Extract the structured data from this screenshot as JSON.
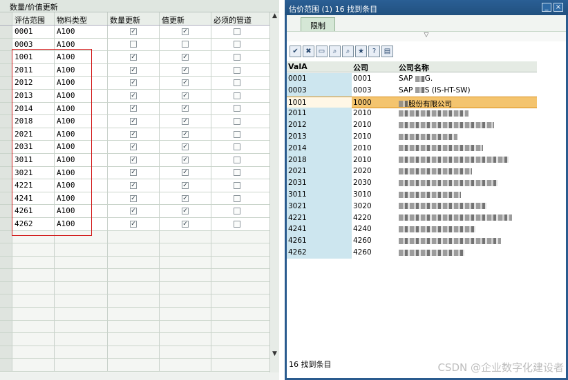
{
  "left": {
    "title": "数量/价值更新",
    "columns": [
      "评估范围",
      "物料类型",
      "数量更新",
      "值更新",
      "必须的管道"
    ],
    "rows": [
      {
        "a": "0001",
        "b": "A100",
        "q": true,
        "v": true,
        "p": false
      },
      {
        "a": "0003",
        "b": "A100",
        "q": false,
        "v": false,
        "p": false
      },
      {
        "a": "1001",
        "b": "A100",
        "q": true,
        "v": true,
        "p": false
      },
      {
        "a": "2011",
        "b": "A100",
        "q": true,
        "v": true,
        "p": false
      },
      {
        "a": "2012",
        "b": "A100",
        "q": true,
        "v": true,
        "p": false
      },
      {
        "a": "2013",
        "b": "A100",
        "q": true,
        "v": true,
        "p": false
      },
      {
        "a": "2014",
        "b": "A100",
        "q": true,
        "v": true,
        "p": false
      },
      {
        "a": "2018",
        "b": "A100",
        "q": true,
        "v": true,
        "p": false
      },
      {
        "a": "2021",
        "b": "A100",
        "q": true,
        "v": true,
        "p": false
      },
      {
        "a": "2031",
        "b": "A100",
        "q": true,
        "v": true,
        "p": false
      },
      {
        "a": "3011",
        "b": "A100",
        "q": true,
        "v": true,
        "p": false
      },
      {
        "a": "3021",
        "b": "A100",
        "q": true,
        "v": true,
        "p": false
      },
      {
        "a": "4221",
        "b": "A100",
        "q": true,
        "v": true,
        "p": false
      },
      {
        "a": "4241",
        "b": "A100",
        "q": true,
        "v": true,
        "p": false
      },
      {
        "a": "4261",
        "b": "A100",
        "q": true,
        "v": true,
        "p": false
      },
      {
        "a": "4262",
        "b": "A100",
        "q": true,
        "v": true,
        "p": false
      }
    ],
    "empty_rows": 11
  },
  "right": {
    "title": "估价范围 (1)   16 找到条目",
    "tab": "限制",
    "cols": [
      "ValA",
      "公司",
      "公司名称"
    ],
    "rows": [
      {
        "a": "0001",
        "b": "0001",
        "c": "SAP",
        "c2": "G."
      },
      {
        "a": "0003",
        "b": "0003",
        "c": "SAP",
        "c2": "S (IS-HT-SW)"
      },
      {
        "a": "1001",
        "b": "1000",
        "c": "",
        "c2": "股份有限公司"
      },
      {
        "a": "2011",
        "b": "2010",
        "c": "",
        "c2": ""
      },
      {
        "a": "2012",
        "b": "2010",
        "c": "",
        "c2": ""
      },
      {
        "a": "2013",
        "b": "2010",
        "c": "",
        "c2": ""
      },
      {
        "a": "2014",
        "b": "2010",
        "c": "",
        "c2": ""
      },
      {
        "a": "2018",
        "b": "2010",
        "c": "",
        "c2": ""
      },
      {
        "a": "2021",
        "b": "2020",
        "c": "",
        "c2": ""
      },
      {
        "a": "2031",
        "b": "2030",
        "c": "",
        "c2": ""
      },
      {
        "a": "3011",
        "b": "3010",
        "c": "",
        "c2": ""
      },
      {
        "a": "3021",
        "b": "3020",
        "c": "",
        "c2": ""
      },
      {
        "a": "4221",
        "b": "4220",
        "c": "",
        "c2": ""
      },
      {
        "a": "4241",
        "b": "4240",
        "c": "",
        "c2": ""
      },
      {
        "a": "4261",
        "b": "4260",
        "c": "",
        "c2": ""
      },
      {
        "a": "4262",
        "b": "4260",
        "c": "",
        "c2": ""
      }
    ],
    "status": "16 找到条目"
  },
  "watermark": "CSDN @企业数字化建设者"
}
